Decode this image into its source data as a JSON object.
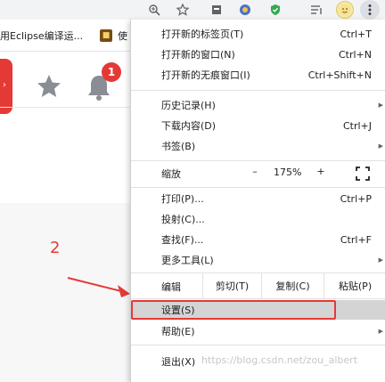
{
  "toolbar": {
    "icons": [
      "zoom-icon",
      "star-icon",
      "extension-icon",
      "extension-icon",
      "shield-icon",
      "playlist-icon",
      "profile-avatar",
      "more-vert-icon"
    ]
  },
  "bookmarks": {
    "items": [
      {
        "label": "用Eclipse编译运..."
      },
      {
        "label": "使"
      }
    ]
  },
  "page": {
    "notification_count": "1"
  },
  "annotation": {
    "step": "2"
  },
  "menu": {
    "new_tab": {
      "label": "打开新的标签页(T)",
      "shortcut": "Ctrl+T"
    },
    "new_window": {
      "label": "打开新的窗口(N)",
      "shortcut": "Ctrl+N"
    },
    "incognito": {
      "label": "打开新的无痕窗口(I)",
      "shortcut": "Ctrl+Shift+N"
    },
    "history": {
      "label": "历史记录(H)"
    },
    "downloads": {
      "label": "下载内容(D)",
      "shortcut": "Ctrl+J"
    },
    "bookmarks": {
      "label": "书签(B)"
    },
    "zoom": {
      "label": "缩放",
      "minus": "–",
      "value": "175%",
      "plus": "+"
    },
    "print": {
      "label": "打印(P)...",
      "shortcut": "Ctrl+P"
    },
    "cast": {
      "label": "投射(C)..."
    },
    "find": {
      "label": "查找(F)...",
      "shortcut": "Ctrl+F"
    },
    "more_tools": {
      "label": "更多工具(L)"
    },
    "edit": {
      "label": "编辑",
      "cut": "剪切(T)",
      "copy": "复制(C)",
      "paste": "粘贴(P)"
    },
    "settings": {
      "label": "设置(S)"
    },
    "help": {
      "label": "帮助(E)"
    },
    "exit": {
      "label": "退出(X)"
    }
  },
  "watermark": "https://blog.csdn.net/zou_albert"
}
